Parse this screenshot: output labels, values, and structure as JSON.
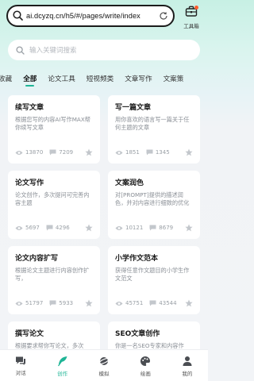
{
  "browser": {
    "url": "ai.dcyzq.cn/h5/#/pages/write/index",
    "toolbox_label": "工具箱"
  },
  "search": {
    "placeholder": "输入关键词搜索"
  },
  "tabs": [
    {
      "label": "收藏",
      "active": false
    },
    {
      "label": "全部",
      "active": true
    },
    {
      "label": "论文工具",
      "active": false
    },
    {
      "label": "短视频类",
      "active": false
    },
    {
      "label": "文章写作",
      "active": false
    },
    {
      "label": "文案策",
      "active": false
    }
  ],
  "cards": [
    {
      "title": "续写文章",
      "desc": "根据您写的内容AI写作MAX帮你续写文章",
      "views": "13870",
      "comments": "7209"
    },
    {
      "title": "写一篇文章",
      "desc": "用你喜欢的语言写一篇关于任何主题的文章",
      "views": "1851",
      "comments": "1345"
    },
    {
      "title": "论文写作",
      "desc": "论文创作，多次提问可完善内容主题",
      "views": "5697",
      "comments": "4296"
    },
    {
      "title": "文案润色",
      "desc": "对[PROMPT]提供的描述润色，并对内容进行细致的优化",
      "views": "10121",
      "comments": "8679"
    },
    {
      "title": "论文内容扩写",
      "desc": "根据论文主题进行内容创作扩写，",
      "views": "51797",
      "comments": "5933"
    },
    {
      "title": "小学作文范本",
      "desc": "获得任意作文题目的小学生作文范文",
      "views": "45751",
      "comments": "43544"
    },
    {
      "title": "撰写论文",
      "desc": "根据要求帮你写论文，多次",
      "views": "",
      "comments": ""
    },
    {
      "title": "SEO文章创作",
      "desc": "你是一名SEO专家和内容作",
      "views": "",
      "comments": ""
    }
  ],
  "nav": [
    {
      "label": "对话",
      "icon": "chat-icon",
      "active": false
    },
    {
      "label": "创作",
      "icon": "feather-icon",
      "active": true
    },
    {
      "label": "模拟",
      "icon": "planet-icon",
      "active": false
    },
    {
      "label": "绘画",
      "icon": "palette-icon",
      "active": false
    },
    {
      "label": "我的",
      "icon": "user-icon",
      "active": false
    }
  ],
  "colors": {
    "accent": "#1fb596",
    "header_gradient_top": "#c7f0e4",
    "background": "#f2f4f7"
  }
}
